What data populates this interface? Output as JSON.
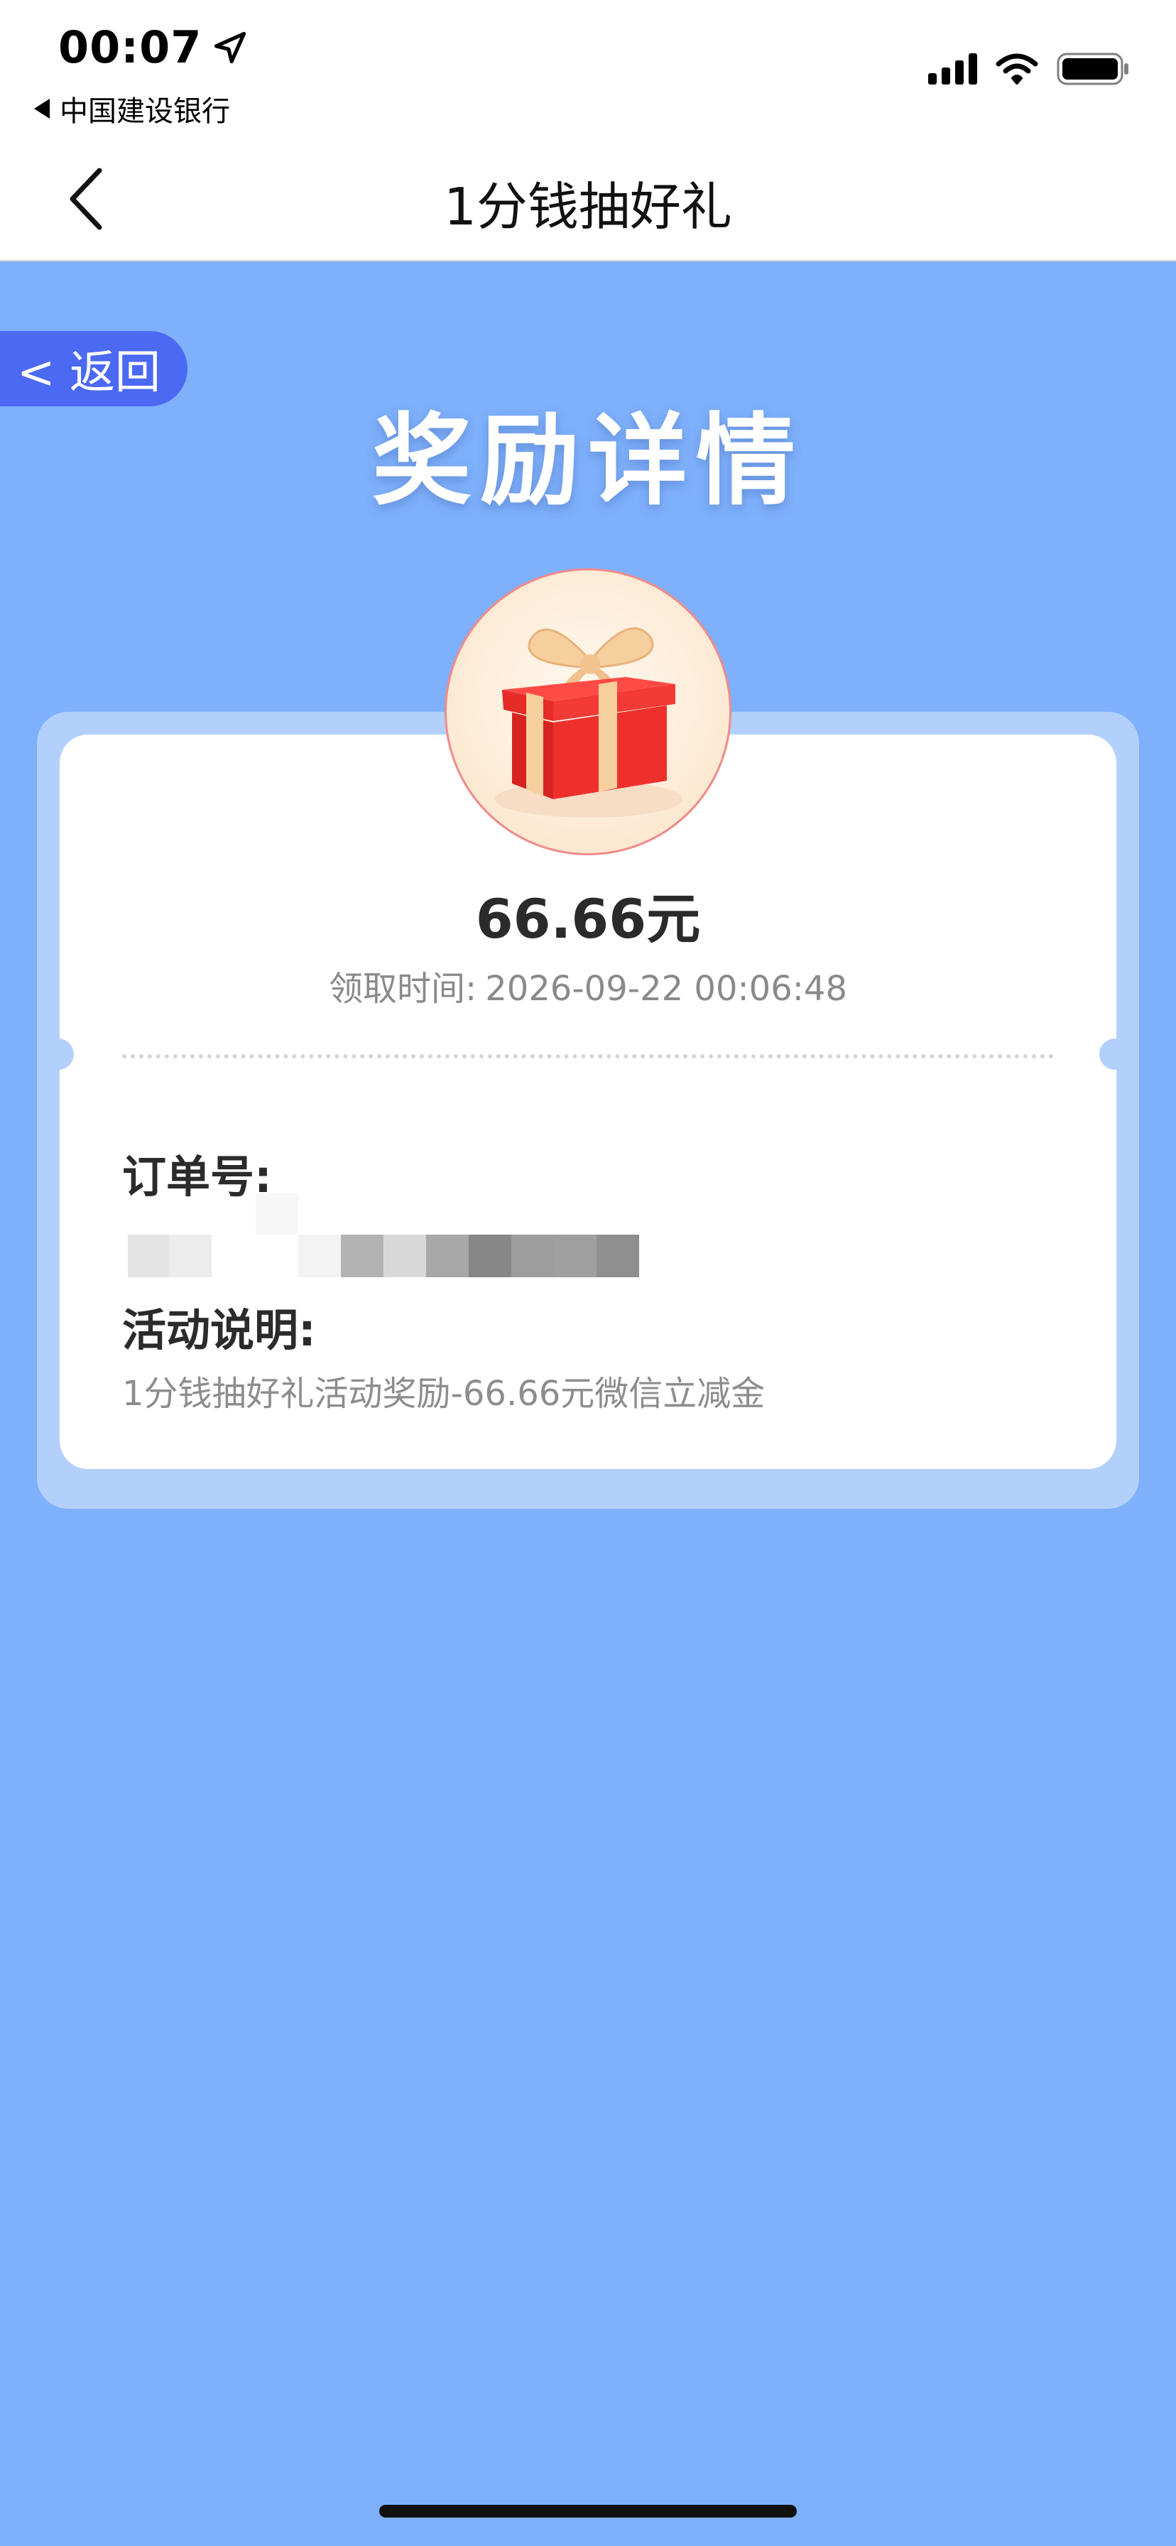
{
  "status_bar": {
    "time": "00:07",
    "back_app_label": "中国建设银行"
  },
  "nav": {
    "title": "1分钱抽好礼"
  },
  "return_button": {
    "label": "< 返回"
  },
  "heading": "奖励详情",
  "reward": {
    "amount": "66.66元",
    "receive_time_label": "领取时间:",
    "receive_time_value": "2026-09-22 00:06:48"
  },
  "order": {
    "label": "订单号:"
  },
  "activity": {
    "label": "活动说明:",
    "description": "1分钱抽好礼活动奖励-66.66元微信立减金"
  },
  "colors": {
    "page_bg": "#7eb0fc",
    "card_frame": "#b3d0fd",
    "return_pill": "#4c69f4",
    "gift_red": "#e8302e"
  },
  "icons": [
    "location-arrow-icon",
    "back-triangle-icon",
    "signal-icon",
    "wifi-icon",
    "battery-icon",
    "chevron-left-icon",
    "gift-icon"
  ]
}
